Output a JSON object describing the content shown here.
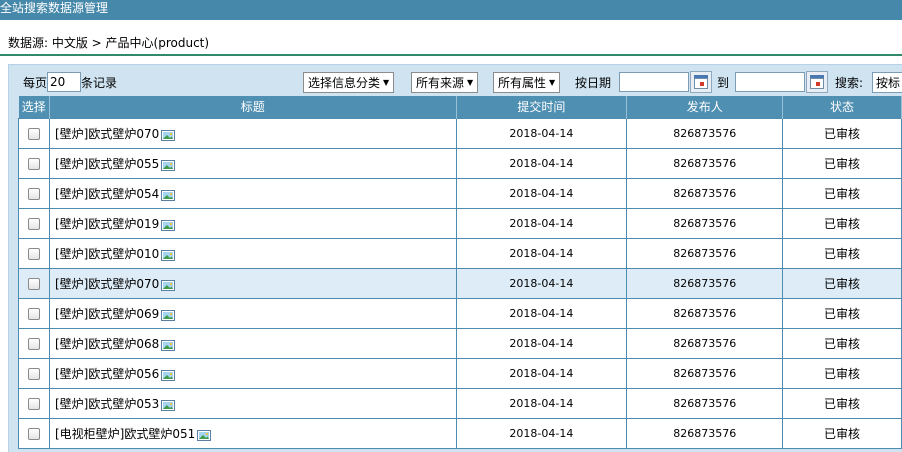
{
  "window": {
    "title": "全站搜索数据源管理"
  },
  "breadcrumb": {
    "text": "数据源: 中文版 > 产品中心(product)"
  },
  "toolbar": {
    "per_page_label": "每页",
    "per_page_value": "20",
    "records_label": "条记录",
    "category_select": "选择信息分类",
    "source_select": "所有来源",
    "attribute_select": "所有属性",
    "date_label": "按日期",
    "date_to_label": "到",
    "search_label": "搜索:",
    "search_type_select": "按标"
  },
  "table": {
    "headers": {
      "select": "选择",
      "title": "标题",
      "submit_time": "提交时间",
      "publisher": "发布人",
      "status": "状态"
    },
    "rows": [
      {
        "title": "[壁炉]欧式壁炉070",
        "submit_time": "2018-04-14",
        "publisher": "826873576",
        "status": "已审核",
        "highlight": false
      },
      {
        "title": "[壁炉]欧式壁炉055",
        "submit_time": "2018-04-14",
        "publisher": "826873576",
        "status": "已审核",
        "highlight": false
      },
      {
        "title": "[壁炉]欧式壁炉054",
        "submit_time": "2018-04-14",
        "publisher": "826873576",
        "status": "已审核",
        "highlight": false
      },
      {
        "title": "[壁炉]欧式壁炉019",
        "submit_time": "2018-04-14",
        "publisher": "826873576",
        "status": "已审核",
        "highlight": false
      },
      {
        "title": "[壁炉]欧式壁炉010",
        "submit_time": "2018-04-14",
        "publisher": "826873576",
        "status": "已审核",
        "highlight": false
      },
      {
        "title": "[壁炉]欧式壁炉070",
        "submit_time": "2018-04-14",
        "publisher": "826873576",
        "status": "已审核",
        "highlight": true
      },
      {
        "title": "[壁炉]欧式壁炉069",
        "submit_time": "2018-04-14",
        "publisher": "826873576",
        "status": "已审核",
        "highlight": false
      },
      {
        "title": "[壁炉]欧式壁炉068",
        "submit_time": "2018-04-14",
        "publisher": "826873576",
        "status": "已审核",
        "highlight": false
      },
      {
        "title": "[壁炉]欧式壁炉056",
        "submit_time": "2018-04-14",
        "publisher": "826873576",
        "status": "已审核",
        "highlight": false
      },
      {
        "title": "[壁炉]欧式壁炉053",
        "submit_time": "2018-04-14",
        "publisher": "826873576",
        "status": "已审核",
        "highlight": false
      },
      {
        "title": "[电视柜壁炉]欧式壁炉051",
        "submit_time": "2018-04-14",
        "publisher": "826873576",
        "status": "已审核",
        "highlight": false
      }
    ]
  },
  "colors": {
    "title_bar": "#4688aa",
    "table_header": "#4f8fb2",
    "panel": "#cfe3f1",
    "highlight_row": "#ddecf7"
  },
  "icons": {
    "row_image": "image-icon",
    "calendar": "calendar-icon"
  }
}
